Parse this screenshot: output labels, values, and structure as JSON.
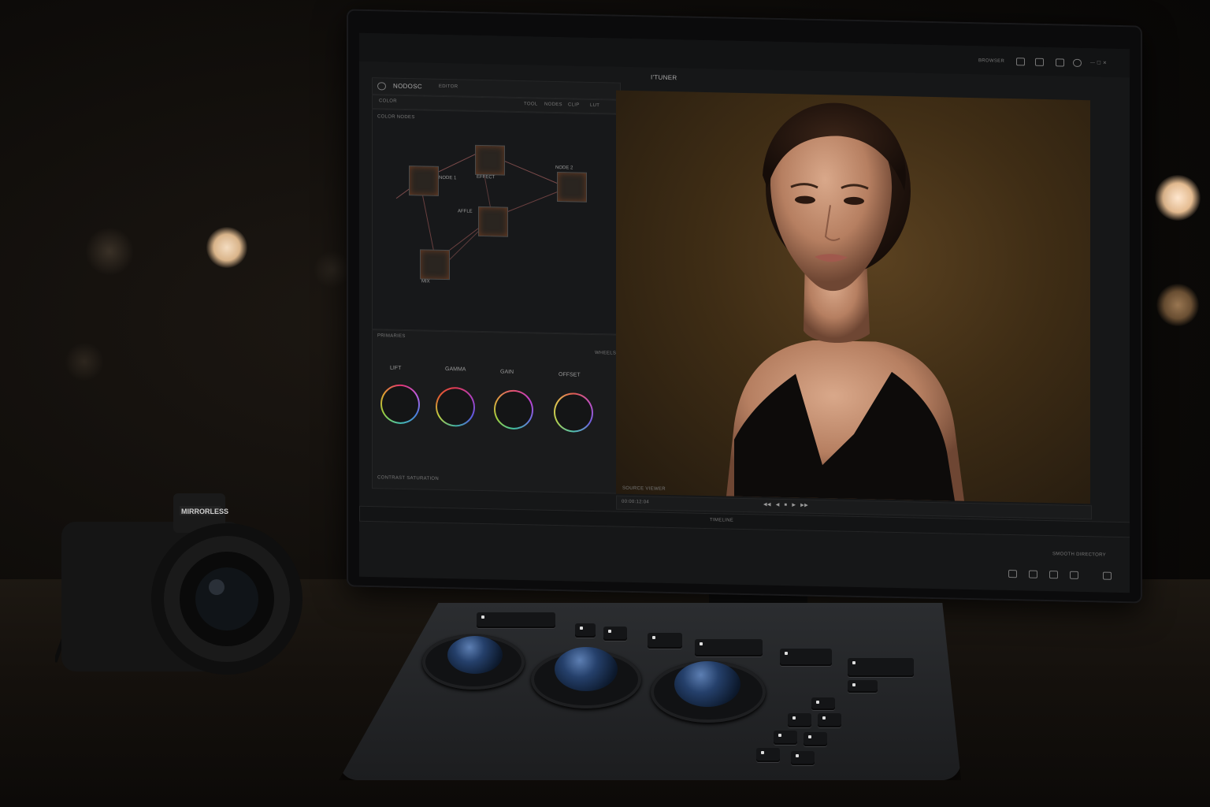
{
  "app": {
    "title": "I'TUNER",
    "logo_text": "NODOSC",
    "top_right_label": "BROWSER"
  },
  "toolbar": {
    "items": [
      "TOOL",
      "NODES",
      "CLIP",
      "LUT"
    ],
    "sub_label": "EDITOR",
    "tab_label": "COLOR"
  },
  "node_editor": {
    "title": "COLOR NODES",
    "nodes": [
      {
        "label": "NODE 1"
      },
      {
        "label": "EFFECT"
      },
      {
        "label": "NODE 2"
      },
      {
        "label": "AFFLE"
      },
      {
        "label": "MIX"
      }
    ]
  },
  "color_panel": {
    "header": "PRIMARIES",
    "mode": "WHEELS",
    "wheels": [
      {
        "label": "LIFT"
      },
      {
        "label": "GAMMA"
      },
      {
        "label": "GAIN"
      },
      {
        "label": "OFFSET"
      }
    ],
    "footer_text": "CONTRAST SATURATION"
  },
  "viewer": {
    "caption": "SOURCE VIEWER",
    "timecode": "00:00:12:04"
  },
  "bottom_bar": {
    "center_label": "TIMELINE",
    "right_label": "SMOOTH DIRECTORY"
  },
  "camera": {
    "brand": "MIRRORLESS"
  },
  "colors": {
    "accent": "#c8a36a",
    "ui_background": "#161718",
    "trackball": "#25406b"
  }
}
